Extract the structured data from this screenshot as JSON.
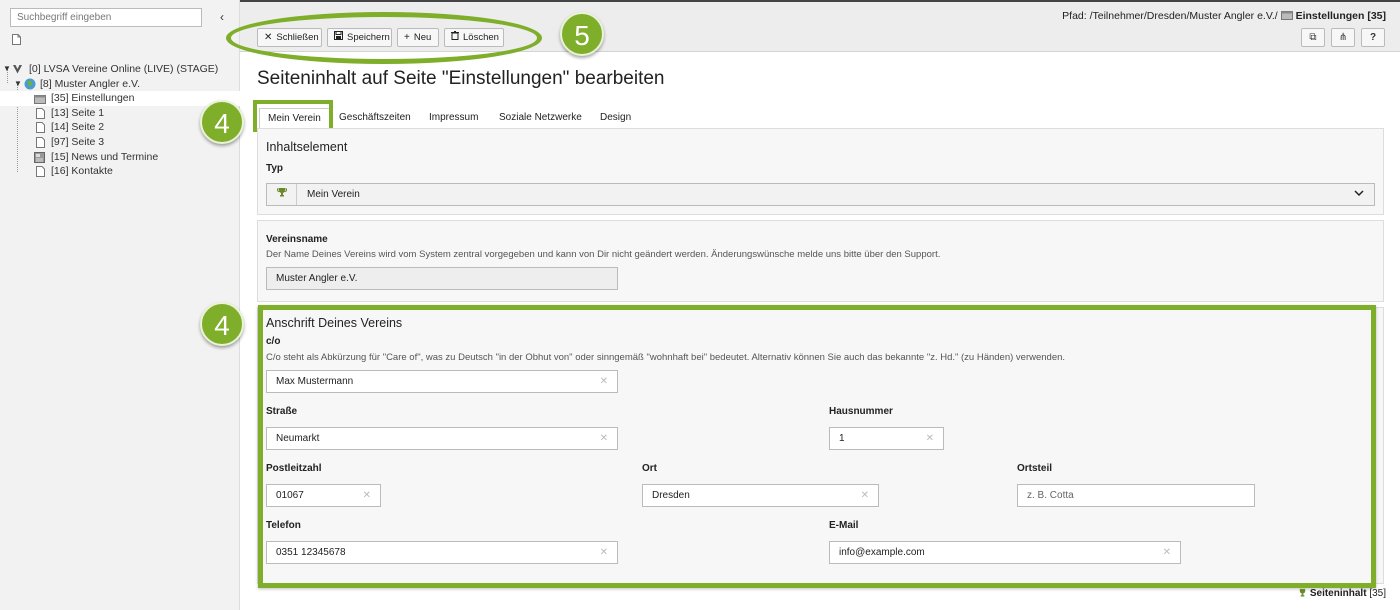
{
  "sidebar": {
    "search_placeholder": "Suchbegriff eingeben",
    "collapse_glyph": "‹",
    "tree": [
      {
        "label": "[0] LVSA Vereine Online (LIVE) (STAGE)",
        "icon": "site-root-icon"
      },
      {
        "label": "[8] Muster Angler e.V.",
        "icon": "globe-icon"
      },
      {
        "label": "[35] Einstellungen",
        "icon": "folder-icon"
      },
      {
        "label": "[13] Seite 1",
        "icon": "page-icon"
      },
      {
        "label": "[14] Seite 2",
        "icon": "page-icon"
      },
      {
        "label": "[97] Seite 3",
        "icon": "page-icon"
      },
      {
        "label": "[15] News und Termine",
        "icon": "news-icon"
      },
      {
        "label": "[16] Kontakte",
        "icon": "page-icon"
      }
    ]
  },
  "toolbar": {
    "close_label": "Schließen",
    "save_label": "Speichern",
    "new_label": "Neu",
    "delete_label": "Löschen",
    "path_prefix": "Pfad: /Teilnehmer/Dresden/Muster Angler e.V./",
    "path_current": "Einstellungen [35]",
    "open_glyph": "⧉",
    "share_glyph": "⋔",
    "help_glyph": "?"
  },
  "annotations": {
    "toolbar_badge": "5",
    "tab_badge": "4",
    "address_badge": "4",
    "accent_color": "#7fae2a"
  },
  "main": {
    "title": "Seiteninhalt auf Seite \"Einstellungen\" bearbeiten",
    "tabs": [
      {
        "label": "Mein Verein",
        "active": true
      },
      {
        "label": "Geschäftszeiten"
      },
      {
        "label": "Impressum"
      },
      {
        "label": "Soziale Netzwerke"
      },
      {
        "label": "Design"
      }
    ],
    "content_element": {
      "section_title": "Inhaltselement",
      "type_label": "Typ",
      "type_value": "Mein Verein"
    },
    "club_name": {
      "label": "Vereinsname",
      "description": "Der Name Deines Vereins wird vom System zentral vorgegeben und kann von Dir nicht geändert werden. Änderungswünsche melde uns bitte über den Support.",
      "value": "Muster Angler e.V."
    },
    "address": {
      "section_title": "Anschrift Deines Vereins",
      "co_label": "c/o",
      "co_description": "C/o steht als Abkürzung für \"Care of\", was zu Deutsch \"in der Obhut von\" oder sinngemäß \"wohnhaft bei\" bedeutet. Alternativ können Sie auch das bekannte \"z. Hd.\" (zu Händen) verwenden.",
      "co_value": "Max Mustermann",
      "street_label": "Straße",
      "street_value": "Neumarkt",
      "house_label": "Hausnummer",
      "house_value": "1",
      "zip_label": "Postleitzahl",
      "zip_value": "01067",
      "city_label": "Ort",
      "city_value": "Dresden",
      "district_label": "Ortsteil",
      "district_placeholder": "z. B. Cotta",
      "phone_label": "Telefon",
      "phone_value": "0351 12345678",
      "email_label": "E-Mail",
      "email_value": "info@example.com"
    }
  },
  "footer": {
    "label": "Seiteninhalt",
    "id": "[35]"
  }
}
